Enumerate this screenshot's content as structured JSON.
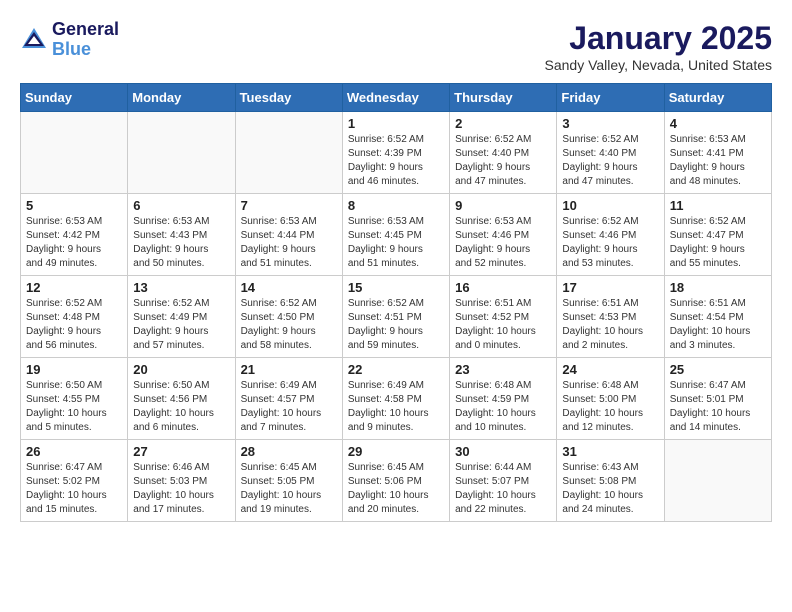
{
  "header": {
    "logo_line1": "General",
    "logo_line2": "Blue",
    "title": "January 2025",
    "subtitle": "Sandy Valley, Nevada, United States"
  },
  "weekdays": [
    "Sunday",
    "Monday",
    "Tuesday",
    "Wednesday",
    "Thursday",
    "Friday",
    "Saturday"
  ],
  "weeks": [
    [
      {
        "day": "",
        "info": ""
      },
      {
        "day": "",
        "info": ""
      },
      {
        "day": "",
        "info": ""
      },
      {
        "day": "1",
        "info": "Sunrise: 6:52 AM\nSunset: 4:39 PM\nDaylight: 9 hours\nand 46 minutes."
      },
      {
        "day": "2",
        "info": "Sunrise: 6:52 AM\nSunset: 4:40 PM\nDaylight: 9 hours\nand 47 minutes."
      },
      {
        "day": "3",
        "info": "Sunrise: 6:52 AM\nSunset: 4:40 PM\nDaylight: 9 hours\nand 47 minutes."
      },
      {
        "day": "4",
        "info": "Sunrise: 6:53 AM\nSunset: 4:41 PM\nDaylight: 9 hours\nand 48 minutes."
      }
    ],
    [
      {
        "day": "5",
        "info": "Sunrise: 6:53 AM\nSunset: 4:42 PM\nDaylight: 9 hours\nand 49 minutes."
      },
      {
        "day": "6",
        "info": "Sunrise: 6:53 AM\nSunset: 4:43 PM\nDaylight: 9 hours\nand 50 minutes."
      },
      {
        "day": "7",
        "info": "Sunrise: 6:53 AM\nSunset: 4:44 PM\nDaylight: 9 hours\nand 51 minutes."
      },
      {
        "day": "8",
        "info": "Sunrise: 6:53 AM\nSunset: 4:45 PM\nDaylight: 9 hours\nand 51 minutes."
      },
      {
        "day": "9",
        "info": "Sunrise: 6:53 AM\nSunset: 4:46 PM\nDaylight: 9 hours\nand 52 minutes."
      },
      {
        "day": "10",
        "info": "Sunrise: 6:52 AM\nSunset: 4:46 PM\nDaylight: 9 hours\nand 53 minutes."
      },
      {
        "day": "11",
        "info": "Sunrise: 6:52 AM\nSunset: 4:47 PM\nDaylight: 9 hours\nand 55 minutes."
      }
    ],
    [
      {
        "day": "12",
        "info": "Sunrise: 6:52 AM\nSunset: 4:48 PM\nDaylight: 9 hours\nand 56 minutes."
      },
      {
        "day": "13",
        "info": "Sunrise: 6:52 AM\nSunset: 4:49 PM\nDaylight: 9 hours\nand 57 minutes."
      },
      {
        "day": "14",
        "info": "Sunrise: 6:52 AM\nSunset: 4:50 PM\nDaylight: 9 hours\nand 58 minutes."
      },
      {
        "day": "15",
        "info": "Sunrise: 6:52 AM\nSunset: 4:51 PM\nDaylight: 9 hours\nand 59 minutes."
      },
      {
        "day": "16",
        "info": "Sunrise: 6:51 AM\nSunset: 4:52 PM\nDaylight: 10 hours\nand 0 minutes."
      },
      {
        "day": "17",
        "info": "Sunrise: 6:51 AM\nSunset: 4:53 PM\nDaylight: 10 hours\nand 2 minutes."
      },
      {
        "day": "18",
        "info": "Sunrise: 6:51 AM\nSunset: 4:54 PM\nDaylight: 10 hours\nand 3 minutes."
      }
    ],
    [
      {
        "day": "19",
        "info": "Sunrise: 6:50 AM\nSunset: 4:55 PM\nDaylight: 10 hours\nand 5 minutes."
      },
      {
        "day": "20",
        "info": "Sunrise: 6:50 AM\nSunset: 4:56 PM\nDaylight: 10 hours\nand 6 minutes."
      },
      {
        "day": "21",
        "info": "Sunrise: 6:49 AM\nSunset: 4:57 PM\nDaylight: 10 hours\nand 7 minutes."
      },
      {
        "day": "22",
        "info": "Sunrise: 6:49 AM\nSunset: 4:58 PM\nDaylight: 10 hours\nand 9 minutes."
      },
      {
        "day": "23",
        "info": "Sunrise: 6:48 AM\nSunset: 4:59 PM\nDaylight: 10 hours\nand 10 minutes."
      },
      {
        "day": "24",
        "info": "Sunrise: 6:48 AM\nSunset: 5:00 PM\nDaylight: 10 hours\nand 12 minutes."
      },
      {
        "day": "25",
        "info": "Sunrise: 6:47 AM\nSunset: 5:01 PM\nDaylight: 10 hours\nand 14 minutes."
      }
    ],
    [
      {
        "day": "26",
        "info": "Sunrise: 6:47 AM\nSunset: 5:02 PM\nDaylight: 10 hours\nand 15 minutes."
      },
      {
        "day": "27",
        "info": "Sunrise: 6:46 AM\nSunset: 5:03 PM\nDaylight: 10 hours\nand 17 minutes."
      },
      {
        "day": "28",
        "info": "Sunrise: 6:45 AM\nSunset: 5:05 PM\nDaylight: 10 hours\nand 19 minutes."
      },
      {
        "day": "29",
        "info": "Sunrise: 6:45 AM\nSunset: 5:06 PM\nDaylight: 10 hours\nand 20 minutes."
      },
      {
        "day": "30",
        "info": "Sunrise: 6:44 AM\nSunset: 5:07 PM\nDaylight: 10 hours\nand 22 minutes."
      },
      {
        "day": "31",
        "info": "Sunrise: 6:43 AM\nSunset: 5:08 PM\nDaylight: 10 hours\nand 24 minutes."
      },
      {
        "day": "",
        "info": ""
      }
    ]
  ]
}
